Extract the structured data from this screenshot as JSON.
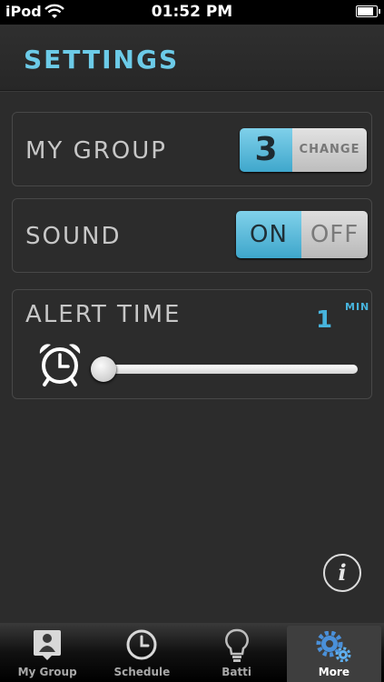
{
  "status_bar": {
    "carrier": "iPod",
    "time": "01:52 PM",
    "battery_level": 0.9
  },
  "header": {
    "title": "SETTINGS"
  },
  "my_group": {
    "label": "MY GROUP",
    "value": "3",
    "change_label": "CHANGE"
  },
  "sound": {
    "label": "SOUND",
    "on_label": "ON",
    "off_label": "OFF",
    "state": "on"
  },
  "alert_time": {
    "label": "ALERT TIME",
    "value": "1",
    "unit": "MIN",
    "slider_fraction": 0.0
  },
  "info": {
    "glyph": "i"
  },
  "tabs": [
    {
      "label": "My Group",
      "icon": "person-icon",
      "selected": false
    },
    {
      "label": "Schedule",
      "icon": "clock-icon",
      "selected": false
    },
    {
      "label": "Batti",
      "icon": "lightbulb-icon",
      "selected": false
    },
    {
      "label": "More",
      "icon": "gears-icon",
      "selected": true
    }
  ],
  "colors": {
    "accent": "#6ccbe8",
    "accent_dark": "#47b4dd",
    "background": "#2c2c2c"
  }
}
